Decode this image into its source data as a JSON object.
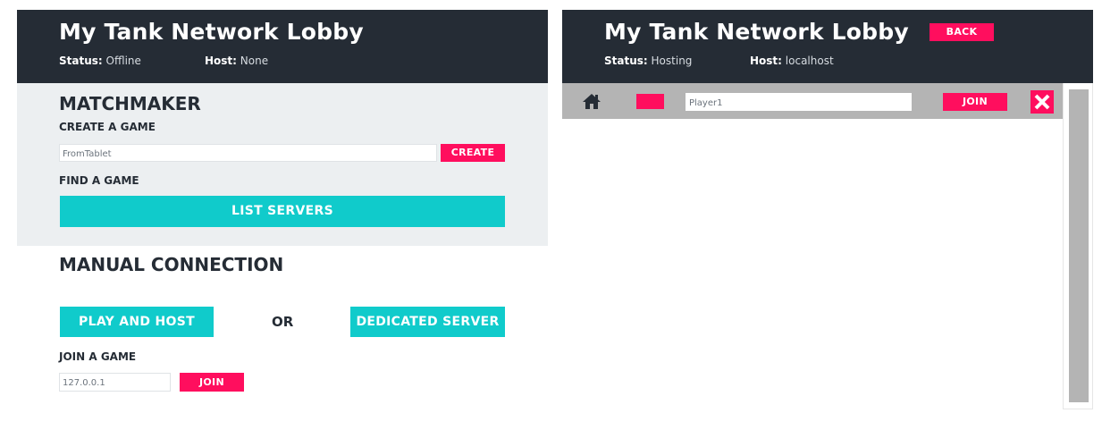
{
  "left": {
    "header": {
      "title": "My Tank Network Lobby",
      "status_label": "Status:",
      "status_value": "Offline",
      "host_label": "Host:",
      "host_value": "None"
    },
    "matchmaker": {
      "heading": "MATCHMAKER",
      "create_heading": "CREATE A GAME",
      "game_name_value": "FromTablet",
      "create_button": "CREATE",
      "find_heading": "FIND A GAME",
      "list_servers_button": "LIST SERVERS"
    },
    "manual": {
      "heading": "MANUAL CONNECTION",
      "play_and_host_button": "PLAY AND HOST",
      "or_text": "OR",
      "dedicated_server_button": "DEDICATED SERVER",
      "join_heading": "JOIN A GAME",
      "ip_value": "127.0.0.1",
      "join_button": "JOIN"
    }
  },
  "right": {
    "header": {
      "title": "My Tank Network Lobby",
      "back_button": "BACK",
      "status_label": "Status:",
      "status_value": "Hosting",
      "host_label": "Host:",
      "host_value": "localhost"
    },
    "lobby_player": {
      "home_icon": "home-icon",
      "player_color": "#ff0e5e",
      "player_name_value": "Player1",
      "join_button": "JOIN",
      "remove_icon": "close-icon"
    }
  },
  "colors": {
    "header_bg": "#252c35",
    "accent_pink": "#ff0e5e",
    "accent_teal": "#10cbcb",
    "section_bg": "#eceff1",
    "lobby_bar_bg": "#b4b4b4"
  }
}
